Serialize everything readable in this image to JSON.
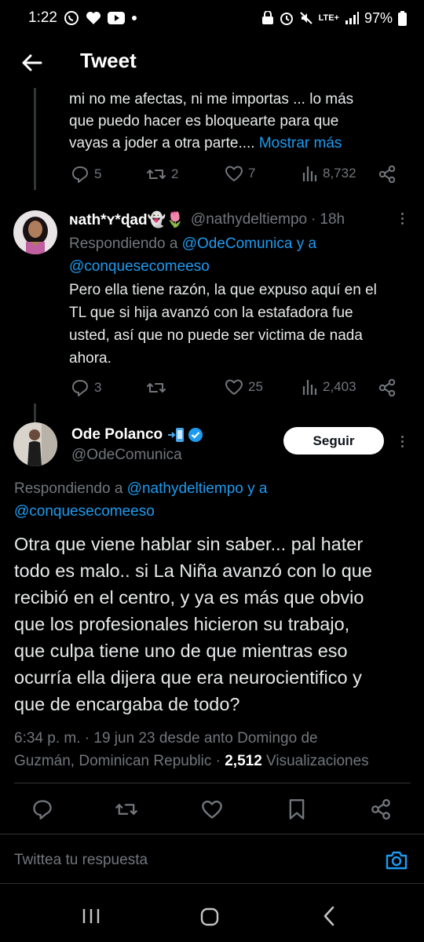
{
  "status_bar": {
    "time": "1:22",
    "battery": "97%",
    "network": "LTE+"
  },
  "header": {
    "title": "Tweet"
  },
  "tweet1": {
    "text_lines": [
      "mi no me afectas, ni me importas ... lo más",
      "que puedo hacer es bloquearte para que",
      "vayas a joder a otra parte.... "
    ],
    "more": "Mostrar más",
    "replies": "5",
    "retweets": "2",
    "likes": "7",
    "views": "8,732"
  },
  "tweet2": {
    "name": "ɴath*ʏ*ɖad👻🌷",
    "handle": "@nathydeltiempo",
    "sep": "·",
    "time": "18h",
    "replying_prefix": "Respondiendo a ",
    "replying_to_1": "@OdeComunica y a",
    "replying_to_2": "@conquesecomeeso",
    "text_lines": [
      "Pero ella tiene razón, la que expuso aquí en el",
      "TL que si hija avanzó con la estafadora fue",
      "usted, así que no puede ser victima de nada",
      "ahora."
    ],
    "replies": "3",
    "retweets": "",
    "likes": "25",
    "views": "2,403"
  },
  "main_tweet": {
    "name": "Ode Polanco",
    "handle": "@OdeComunica",
    "follow_label": "Seguir",
    "replying_prefix": "Respondiendo a ",
    "replying_to_1": "@nathydeltiempo y a",
    "replying_to_2": "@conquesecomeeso",
    "text_lines": [
      "Otra que viene hablar sin saber... pal hater",
      "todo es malo.. si La Niña avanzó con lo que",
      "recibió en el centro, y ya es más que obvio",
      "que los profesionales hicieron su trabajo,",
      "que culpa tiene uno de que mientras eso",
      "ocurría ella dijera que era neurocientifico y",
      "que de encargaba de todo?"
    ],
    "meta_line1": "6:34 p. m. · 19 jun 23 desde anto Domingo de",
    "meta_line2_prefix": "Guzmán, Dominican Republic · ",
    "views_count": "2,512",
    "views_label": " Visualizaciones"
  },
  "reply_bar": {
    "placeholder": "Twittea tu respuesta"
  },
  "colors": {
    "accent": "#1d9bf0",
    "muted": "#71767b",
    "background": "#000000",
    "verified": "#1d9bf0"
  }
}
